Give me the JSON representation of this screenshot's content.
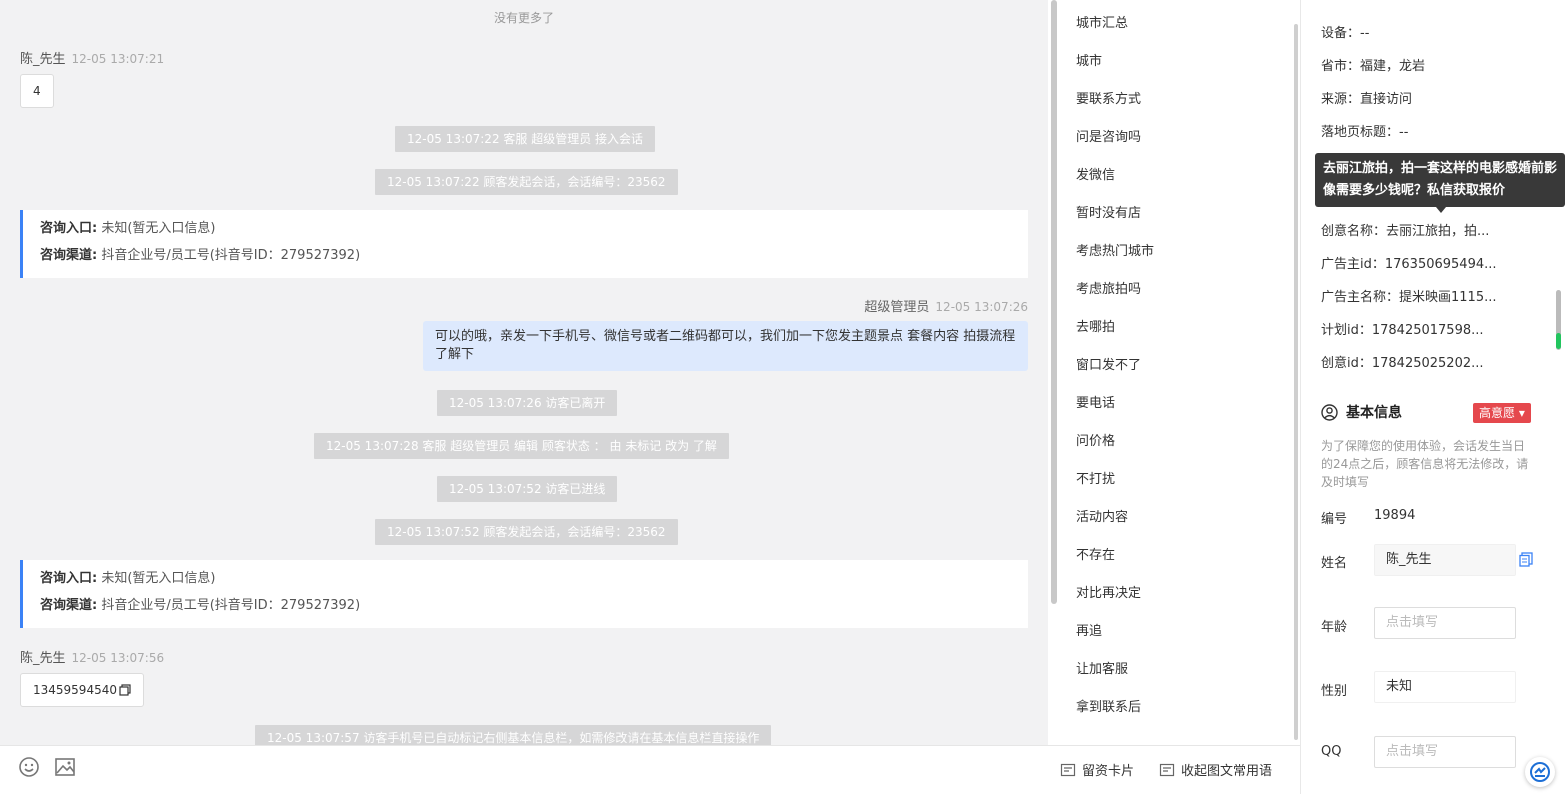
{
  "chat": {
    "no_more": "没有更多了",
    "msg1": {
      "sender": "陈_先生",
      "time": "12-05 13:07:21",
      "text": "4"
    },
    "sys1": "12-05 13:07:22 客服 超级管理员 接入会话",
    "sys2": "12-05 13:07:22 顾客发起会话，会话编号：23562",
    "entry1": {
      "entry_label": "咨询入口:",
      "entry_value": "未知(暂无入口信息)",
      "channel_label": "咨询渠道:",
      "channel_value": "抖音企业号/员工号(抖音号ID：279527392)"
    },
    "agent": {
      "name": "超级管理员",
      "time": "12-05 13:07:26",
      "text": "可以的哦，亲发一下手机号、微信号或者二维码都可以，我们加一下您发主题景点 套餐内容 拍摄流程了解下"
    },
    "sys3": "12-05 13:07:26 访客已离开",
    "sys4": "12-05 13:07:28 客服 超级管理员 编辑 顾客状态 ： 由 未标记 改为 了解",
    "sys5": "12-05 13:07:52 访客已进线",
    "sys6": "12-05 13:07:52 顾客发起会话，会话编号：23562",
    "entry2": {
      "entry_label": "咨询入口:",
      "entry_value": "未知(暂无入口信息)",
      "channel_label": "咨询渠道:",
      "channel_value": "抖音企业号/员工号(抖音号ID：279527392)"
    },
    "msg2": {
      "sender": "陈_先生",
      "time": "12-05 13:07:56",
      "text": "13459594540"
    },
    "sys7": "12-05 13:07:57 访客手机号已自动标记右侧基本信息栏，如需修改请在基本信息栏直接操作"
  },
  "toolbar": {
    "emoji_icon": "smile-icon",
    "image_icon": "image-icon"
  },
  "quick_replies": [
    "城市汇总",
    "城市",
    "要联系方式",
    "问是咨询吗",
    "发微信",
    "暂时没有店",
    "考虑热门城市",
    "考虑旅拍吗",
    "去哪拍",
    "窗口发不了",
    "要电话",
    "问价格",
    "不打扰",
    "活动内容",
    "不存在",
    "对比再决定",
    "再追",
    "让加客服",
    "拿到联系后"
  ],
  "quick_bar": {
    "card": "留资卡片",
    "collapse": "收起图文常用语"
  },
  "info": {
    "device": "设备：--",
    "province": "省市：福建，龙岩",
    "source": "来源：直接访问",
    "landing_title": "落地页标题：--",
    "tooltip": "去丽江旅拍，拍一套这样的电影感婚前影像需要多少钱呢？私信获取报价",
    "creative_name": "创意名称：去丽江旅拍，拍...",
    "advertiser_id": "广告主id：176350695494...",
    "advertiser_name": "广告主名称：提米映画1115...",
    "plan_id": "计划id：178425017598...",
    "creative_id": "创意id：178425025202...",
    "basic_title": "基本信息",
    "intent_badge": "高意愿",
    "notice": "为了保障您的使用体验，会话发生当日的24点之后，顾客信息将无法修改，请及时填写",
    "fields": {
      "number_label": "编号",
      "number_value": "19894",
      "name_label": "姓名",
      "name_value": "陈_先生",
      "age_label": "年龄",
      "age_placeholder": "点击填写",
      "gender_label": "性别",
      "gender_value": "未知",
      "qq_label": "QQ",
      "qq_placeholder": "点击填写"
    }
  },
  "colors": {
    "accent": "#3b82f6",
    "badge": "#e5484d",
    "agent_bubble": "#dde9fd",
    "system_msg": "#d6d6d7"
  }
}
